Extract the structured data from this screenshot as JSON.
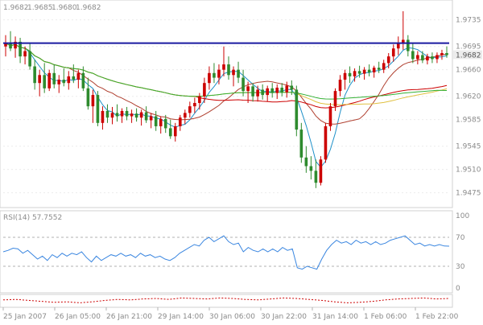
{
  "chart_data": [
    {
      "type": "candlestick",
      "panel": "price",
      "title": "",
      "header_values": [
        "1.9682",
        "1.9685",
        "1.9680",
        "1.9682"
      ],
      "current_price_label": "1.9682",
      "ylim": [
        1.946,
        1.976
      ],
      "yticks": [
        1.9735,
        1.9695,
        1.966,
        1.962,
        1.9585,
        1.9545,
        1.951,
        1.9475
      ],
      "horizontal_line": {
        "value": 1.97,
        "color": "#1a1aa0"
      },
      "colors": {
        "up": "#cc0000",
        "down": "#2e8b2e",
        "ma_fast": "#1e90c8",
        "ma_mid": "#b04030",
        "ma_slow": "#cc0000",
        "ma_yellow": "#e0c040",
        "ma_green": "#33b033"
      },
      "ohlc": [
        [
          1.9695,
          1.9712,
          1.968,
          1.97
        ],
        [
          1.97,
          1.9718,
          1.9688,
          1.9692
        ],
        [
          1.9692,
          1.971,
          1.9678,
          1.9702
        ],
        [
          1.9702,
          1.9708,
          1.967,
          1.968
        ],
        [
          1.968,
          1.9695,
          1.9668,
          1.9688
        ],
        [
          1.9688,
          1.97,
          1.966,
          1.9665
        ],
        [
          1.9665,
          1.9675,
          1.963,
          1.964
        ],
        [
          1.964,
          1.966,
          1.962,
          1.9652
        ],
        [
          1.9652,
          1.967,
          1.9625,
          1.9632
        ],
        [
          1.9632,
          1.966,
          1.9628,
          1.9655
        ],
        [
          1.9655,
          1.9668,
          1.9632,
          1.9638
        ],
        [
          1.9638,
          1.9652,
          1.9625,
          1.9645
        ],
        [
          1.9645,
          1.9662,
          1.9635,
          1.964
        ],
        [
          1.964,
          1.9658,
          1.963,
          1.965
        ],
        [
          1.965,
          1.9668,
          1.964,
          1.9645
        ],
        [
          1.9645,
          1.966,
          1.9632,
          1.9655
        ],
        [
          1.9655,
          1.9665,
          1.9628,
          1.9632
        ],
        [
          1.9632,
          1.9648,
          1.96,
          1.9605
        ],
        [
          1.9605,
          1.963,
          1.958,
          1.9622
        ],
        [
          1.9622,
          1.9628,
          1.9575,
          1.958
        ],
        [
          1.958,
          1.9605,
          1.957,
          1.9598
        ],
        [
          1.9598,
          1.9608,
          1.958,
          1.9588
        ],
        [
          1.9588,
          1.9604,
          1.9578,
          1.9595
        ],
        [
          1.9595,
          1.9608,
          1.9582,
          1.959
        ],
        [
          1.959,
          1.9602,
          1.958,
          1.9598
        ],
        [
          1.9598,
          1.9604,
          1.9584,
          1.959
        ],
        [
          1.959,
          1.96,
          1.958,
          1.9594
        ],
        [
          1.9594,
          1.9602,
          1.9582,
          1.9588
        ],
        [
          1.9588,
          1.96,
          1.9576,
          1.9596
        ],
        [
          1.9596,
          1.9605,
          1.958,
          1.9584
        ],
        [
          1.9584,
          1.9595,
          1.9572,
          1.959
        ],
        [
          1.959,
          1.9598,
          1.9568,
          1.9575
        ],
        [
          1.9575,
          1.959,
          1.9564,
          1.9586
        ],
        [
          1.9586,
          1.9592,
          1.9565,
          1.9572
        ],
        [
          1.9572,
          1.9585,
          1.9556,
          1.956
        ],
        [
          1.956,
          1.958,
          1.9552,
          1.9575
        ],
        [
          1.9575,
          1.9592,
          1.9568,
          1.9588
        ],
        [
          1.9588,
          1.96,
          1.9578,
          1.9595
        ],
        [
          1.9595,
          1.9612,
          1.9588,
          1.9605
        ],
        [
          1.9605,
          1.9618,
          1.9595,
          1.961
        ],
        [
          1.961,
          1.9625,
          1.96,
          1.962
        ],
        [
          1.962,
          1.9648,
          1.961,
          1.964
        ],
        [
          1.964,
          1.9665,
          1.963,
          1.9655
        ],
        [
          1.9655,
          1.967,
          1.964,
          1.9648
        ],
        [
          1.9648,
          1.9668,
          1.9638,
          1.966
        ],
        [
          1.966,
          1.9695,
          1.965,
          1.9668
        ],
        [
          1.9668,
          1.968,
          1.9645,
          1.9652
        ],
        [
          1.9652,
          1.9665,
          1.9635,
          1.966
        ],
        [
          1.966,
          1.9672,
          1.964,
          1.9648
        ],
        [
          1.9648,
          1.966,
          1.962,
          1.9628
        ],
        [
          1.9628,
          1.9642,
          1.961,
          1.9635
        ],
        [
          1.9635,
          1.964,
          1.9612,
          1.962
        ],
        [
          1.962,
          1.9636,
          1.9612,
          1.963
        ],
        [
          1.963,
          1.9638,
          1.9615,
          1.9622
        ],
        [
          1.9622,
          1.9636,
          1.9612,
          1.9632
        ],
        [
          1.9632,
          1.964,
          1.9618,
          1.9625
        ],
        [
          1.9625,
          1.9638,
          1.9616,
          1.9633
        ],
        [
          1.9633,
          1.964,
          1.962,
          1.9626
        ],
        [
          1.9626,
          1.9642,
          1.9618,
          1.9636
        ],
        [
          1.9636,
          1.9644,
          1.9622,
          1.963
        ],
        [
          1.963,
          1.9636,
          1.956,
          1.957
        ],
        [
          1.957,
          1.958,
          1.952,
          1.9528
        ],
        [
          1.9528,
          1.9545,
          1.9505,
          1.9515
        ],
        [
          1.9515,
          1.953,
          1.9495,
          1.9508
        ],
        [
          1.9508,
          1.9525,
          1.9482,
          1.949
        ],
        [
          1.949,
          1.953,
          1.9486,
          1.9525
        ],
        [
          1.9525,
          1.958,
          1.952,
          1.9575
        ],
        [
          1.9575,
          1.961,
          1.9568,
          1.9605
        ],
        [
          1.9605,
          1.9632,
          1.9598,
          1.9628
        ],
        [
          1.9628,
          1.9652,
          1.962,
          1.9645
        ],
        [
          1.9645,
          1.966,
          1.963,
          1.9655
        ],
        [
          1.9655,
          1.9665,
          1.964,
          1.965
        ],
        [
          1.965,
          1.9662,
          1.9642,
          1.9658
        ],
        [
          1.9658,
          1.9666,
          1.9648,
          1.9654
        ],
        [
          1.9654,
          1.9664,
          1.9645,
          1.966
        ],
        [
          1.966,
          1.9668,
          1.965,
          1.9656
        ],
        [
          1.9656,
          1.9666,
          1.9648,
          1.9663
        ],
        [
          1.9663,
          1.9672,
          1.9655,
          1.966
        ],
        [
          1.966,
          1.9675,
          1.9655,
          1.967
        ],
        [
          1.967,
          1.9685,
          1.9662,
          1.968
        ],
        [
          1.968,
          1.9698,
          1.9672,
          1.9692
        ],
        [
          1.9692,
          1.971,
          1.9682,
          1.97
        ],
        [
          1.97,
          1.9748,
          1.969,
          1.9705
        ],
        [
          1.9705,
          1.9712,
          1.968,
          1.9688
        ],
        [
          1.9688,
          1.97,
          1.967,
          1.9676
        ],
        [
          1.9676,
          1.9688,
          1.9668,
          1.9682
        ],
        [
          1.9682,
          1.9688,
          1.967,
          1.9674
        ],
        [
          1.9674,
          1.9684,
          1.9668,
          1.968
        ],
        [
          1.968,
          1.9686,
          1.967,
          1.9676
        ],
        [
          1.9676,
          1.9686,
          1.967,
          1.9682
        ],
        [
          1.9682,
          1.969,
          1.9675,
          1.9685
        ],
        [
          1.9685,
          1.9695,
          1.9678,
          1.9682
        ]
      ]
    },
    {
      "type": "line",
      "panel": "indicator",
      "title": "RSI(14) 57.7552",
      "ylim": [
        0,
        100
      ],
      "yticks": [
        100,
        70,
        30,
        0
      ],
      "levels": [
        70,
        30
      ],
      "values": [
        50,
        52,
        55,
        54,
        48,
        52,
        46,
        40,
        44,
        38,
        46,
        42,
        48,
        44,
        48,
        46,
        50,
        42,
        36,
        44,
        38,
        42,
        46,
        44,
        48,
        44,
        46,
        42,
        48,
        44,
        46,
        42,
        44,
        40,
        38,
        42,
        48,
        52,
        56,
        60,
        58,
        66,
        70,
        64,
        68,
        72,
        64,
        60,
        62,
        50,
        56,
        52,
        50,
        54,
        50,
        54,
        50,
        56,
        52,
        54,
        28,
        26,
        30,
        28,
        26,
        40,
        52,
        60,
        66,
        62,
        64,
        60,
        66,
        62,
        64,
        60,
        64,
        60,
        62,
        66,
        68,
        70,
        72,
        66,
        60,
        62,
        58,
        60,
        58,
        60,
        58,
        57.76
      ]
    },
    {
      "type": "line",
      "panel": "oscillator",
      "title": "",
      "values": [
        0.2,
        0.3,
        0.1,
        -0.1,
        -0.3,
        -0.2,
        -0.4,
        -0.2,
        0.1,
        0.3,
        0.2,
        0.4,
        0.5,
        0.3,
        0.6,
        0.5,
        0.4,
        0.6,
        0.5,
        0.3,
        0.2,
        0.4,
        0.6,
        0.5,
        0.3,
        0.1,
        -0.2,
        -0.4,
        -0.3,
        -0.1,
        0.2,
        0.4,
        0.5,
        0.6,
        0.4,
        0.5
      ]
    }
  ],
  "x_axis": {
    "tick_labels": [
      "25 Jan 2007",
      "26 Jan 05:00",
      "26 Jan 21:00",
      "29 Jan 14:00",
      "30 Jan 06:00",
      "30 Jan 22:00",
      "31 Jan 14:00",
      "1 Feb 06:00",
      "1 Feb 22:00"
    ]
  }
}
